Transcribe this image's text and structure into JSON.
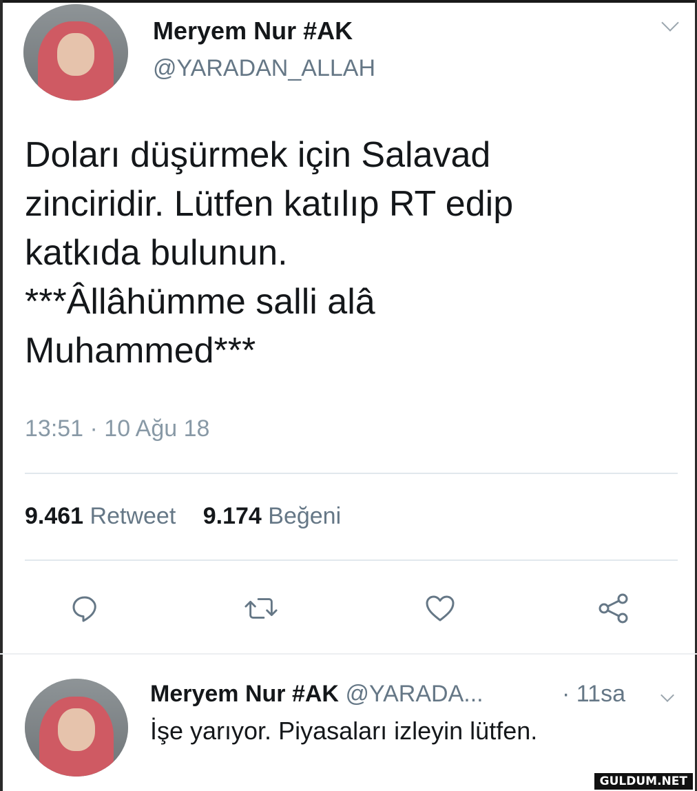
{
  "tweet": {
    "author_name": "Meryem Nur #AK",
    "author_handle": "@YARADAN_ALLAH",
    "text_lines": [
      "Doları düşürmek için Salavad",
      "zinciridir.  Lütfen katılıp RT edip",
      "katkıda bulunun.",
      "***Âllâhümme salli alâ",
      "Muhammed***"
    ],
    "timestamp": "13:51 · 10 Ağu 18",
    "retweet_count": "9.461",
    "retweet_label": "Retweet",
    "like_count": "9.174",
    "like_label": "Beğeni"
  },
  "actions": {
    "reply_icon": "reply-icon",
    "retweet_icon": "retweet-icon",
    "like_icon": "heart-icon",
    "share_icon": "share-icon"
  },
  "reply": {
    "author_name": "Meryem Nur #AK",
    "author_handle": "@YARADA...",
    "time": "· 11sa",
    "text": "İşe yarıyor. Piyasaları izleyin lütfen."
  },
  "watermark": "GULDUM.NET",
  "colors": {
    "text": "#14171a",
    "secondary": "#657786",
    "divider": "#e1e8ed",
    "icon": "#657786"
  }
}
